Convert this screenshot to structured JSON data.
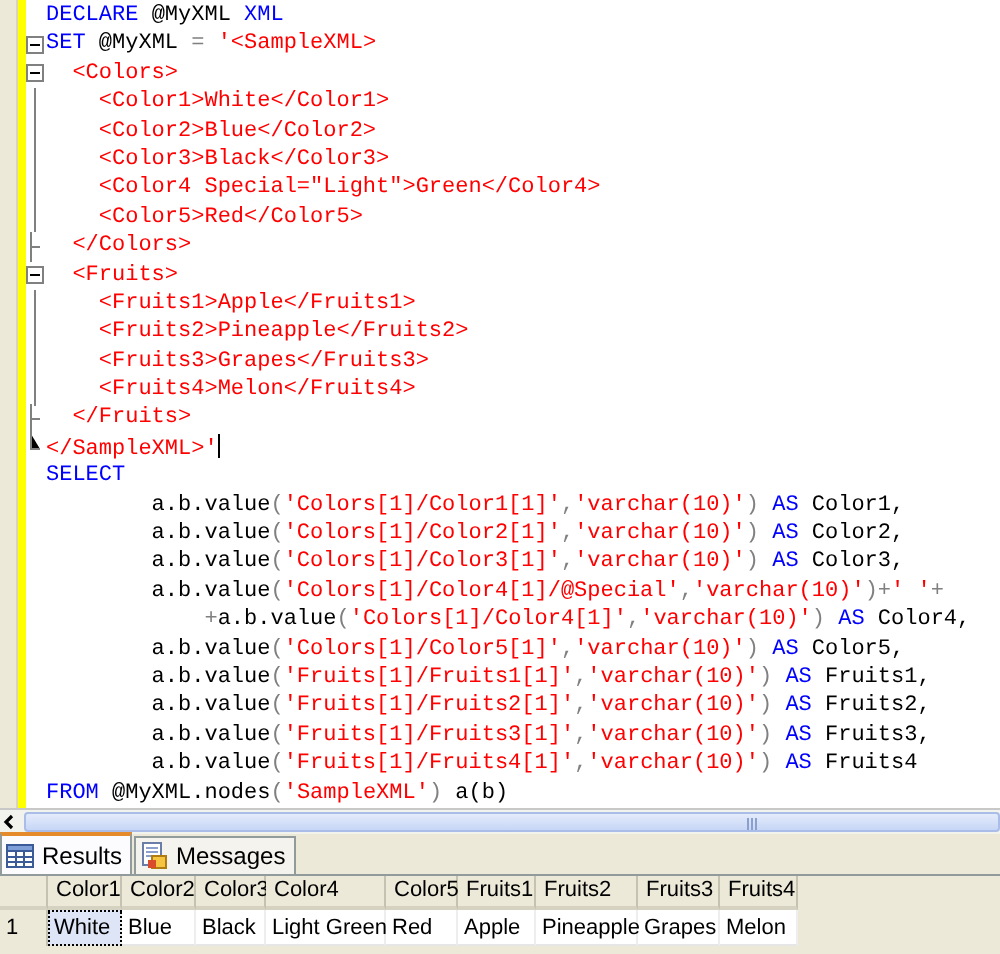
{
  "editor": {
    "lines": [
      {
        "kind": "plain",
        "cursor": false,
        "tokens": [
          {
            "kind": "keyword",
            "text": "DECLARE"
          },
          {
            "kind": "plain",
            "text": " @MyXML "
          },
          {
            "kind": "keyword",
            "text": "XML"
          }
        ]
      },
      {
        "kind": "open",
        "cursor": false,
        "tokens": [
          {
            "kind": "keyword",
            "text": "SET"
          },
          {
            "kind": "plain",
            "text": " @MyXML "
          },
          {
            "kind": "operator",
            "text": "= "
          },
          {
            "kind": "string",
            "text": "'<SampleXML>"
          }
        ]
      },
      {
        "kind": "open",
        "cursor": false,
        "tokens": [
          {
            "kind": "string",
            "text": "  <Colors>"
          }
        ]
      },
      {
        "kind": "line",
        "cursor": false,
        "tokens": [
          {
            "kind": "string",
            "text": "    <Color1>White</Color1>"
          }
        ]
      },
      {
        "kind": "line",
        "cursor": false,
        "tokens": [
          {
            "kind": "string",
            "text": "    <Color2>Blue</Color2>"
          }
        ]
      },
      {
        "kind": "line",
        "cursor": false,
        "tokens": [
          {
            "kind": "string",
            "text": "    <Color3>Black</Color3>"
          }
        ]
      },
      {
        "kind": "line",
        "cursor": false,
        "tokens": [
          {
            "kind": "string",
            "text": "    <Color4 Special=\"Light\">Green</Color4>"
          }
        ]
      },
      {
        "kind": "line",
        "cursor": false,
        "tokens": [
          {
            "kind": "string",
            "text": "    <Color5>Red</Color5>"
          }
        ]
      },
      {
        "kind": "end",
        "cursor": false,
        "tokens": [
          {
            "kind": "string",
            "text": "  </Colors>"
          }
        ]
      },
      {
        "kind": "open",
        "cursor": false,
        "tokens": [
          {
            "kind": "string",
            "text": "  <Fruits>"
          }
        ]
      },
      {
        "kind": "line",
        "cursor": false,
        "tokens": [
          {
            "kind": "string",
            "text": "    <Fruits1>Apple</Fruits1>"
          }
        ]
      },
      {
        "kind": "line",
        "cursor": false,
        "tokens": [
          {
            "kind": "string",
            "text": "    <Fruits2>Pineapple</Fruits2>"
          }
        ]
      },
      {
        "kind": "line",
        "cursor": false,
        "tokens": [
          {
            "kind": "string",
            "text": "    <Fruits3>Grapes</Fruits3>"
          }
        ]
      },
      {
        "kind": "line",
        "cursor": false,
        "tokens": [
          {
            "kind": "string",
            "text": "    <Fruits4>Melon</Fruits4>"
          }
        ]
      },
      {
        "kind": "end",
        "cursor": false,
        "tokens": [
          {
            "kind": "string",
            "text": "  </Fruits>"
          }
        ]
      },
      {
        "kind": "last",
        "cursor": true,
        "tokens": [
          {
            "kind": "string",
            "text": "</SampleXML>'"
          }
        ]
      },
      {
        "kind": "plain",
        "cursor": false,
        "tokens": [
          {
            "kind": "keyword",
            "text": "SELECT"
          }
        ]
      },
      {
        "kind": "plain",
        "cursor": false,
        "tokens": [
          {
            "kind": "plain",
            "text": "        a.b.value"
          },
          {
            "kind": "operator",
            "text": "("
          },
          {
            "kind": "string",
            "text": "'Colors[1]/Color1[1]'"
          },
          {
            "kind": "operator",
            "text": ","
          },
          {
            "kind": "string",
            "text": "'varchar(10)'"
          },
          {
            "kind": "operator",
            "text": ") "
          },
          {
            "kind": "keyword",
            "text": "AS"
          },
          {
            "kind": "plain",
            "text": " Color1,"
          }
        ]
      },
      {
        "kind": "plain",
        "cursor": false,
        "tokens": [
          {
            "kind": "plain",
            "text": "        a.b.value"
          },
          {
            "kind": "operator",
            "text": "("
          },
          {
            "kind": "string",
            "text": "'Colors[1]/Color2[1]'"
          },
          {
            "kind": "operator",
            "text": ","
          },
          {
            "kind": "string",
            "text": "'varchar(10)'"
          },
          {
            "kind": "operator",
            "text": ") "
          },
          {
            "kind": "keyword",
            "text": "AS"
          },
          {
            "kind": "plain",
            "text": " Color2,"
          }
        ]
      },
      {
        "kind": "plain",
        "cursor": false,
        "tokens": [
          {
            "kind": "plain",
            "text": "        a.b.value"
          },
          {
            "kind": "operator",
            "text": "("
          },
          {
            "kind": "string",
            "text": "'Colors[1]/Color3[1]'"
          },
          {
            "kind": "operator",
            "text": ","
          },
          {
            "kind": "string",
            "text": "'varchar(10)'"
          },
          {
            "kind": "operator",
            "text": ") "
          },
          {
            "kind": "keyword",
            "text": "AS"
          },
          {
            "kind": "plain",
            "text": " Color3,"
          }
        ]
      },
      {
        "kind": "plain",
        "cursor": false,
        "tokens": [
          {
            "kind": "plain",
            "text": "        a.b.value"
          },
          {
            "kind": "operator",
            "text": "("
          },
          {
            "kind": "string",
            "text": "'Colors[1]/Color4[1]/@Special'"
          },
          {
            "kind": "operator",
            "text": ","
          },
          {
            "kind": "string",
            "text": "'varchar(10)'"
          },
          {
            "kind": "operator",
            "text": ")+"
          },
          {
            "kind": "string",
            "text": "' '"
          },
          {
            "kind": "operator",
            "text": "+"
          }
        ]
      },
      {
        "kind": "plain",
        "cursor": false,
        "tokens": [
          {
            "kind": "operator",
            "text": "            +"
          },
          {
            "kind": "plain",
            "text": "a.b.value"
          },
          {
            "kind": "operator",
            "text": "("
          },
          {
            "kind": "string",
            "text": "'Colors[1]/Color4[1]'"
          },
          {
            "kind": "operator",
            "text": ","
          },
          {
            "kind": "string",
            "text": "'varchar(10)'"
          },
          {
            "kind": "operator",
            "text": ") "
          },
          {
            "kind": "keyword",
            "text": "AS"
          },
          {
            "kind": "plain",
            "text": " Color4,"
          }
        ]
      },
      {
        "kind": "plain",
        "cursor": false,
        "tokens": [
          {
            "kind": "plain",
            "text": "        a.b.value"
          },
          {
            "kind": "operator",
            "text": "("
          },
          {
            "kind": "string",
            "text": "'Colors[1]/Color5[1]'"
          },
          {
            "kind": "operator",
            "text": ","
          },
          {
            "kind": "string",
            "text": "'varchar(10)'"
          },
          {
            "kind": "operator",
            "text": ") "
          },
          {
            "kind": "keyword",
            "text": "AS"
          },
          {
            "kind": "plain",
            "text": " Color5,"
          }
        ]
      },
      {
        "kind": "plain",
        "cursor": false,
        "tokens": [
          {
            "kind": "plain",
            "text": "        a.b.value"
          },
          {
            "kind": "operator",
            "text": "("
          },
          {
            "kind": "string",
            "text": "'Fruits[1]/Fruits1[1]'"
          },
          {
            "kind": "operator",
            "text": ","
          },
          {
            "kind": "string",
            "text": "'varchar(10)'"
          },
          {
            "kind": "operator",
            "text": ") "
          },
          {
            "kind": "keyword",
            "text": "AS"
          },
          {
            "kind": "plain",
            "text": " Fruits1,"
          }
        ]
      },
      {
        "kind": "plain",
        "cursor": false,
        "tokens": [
          {
            "kind": "plain",
            "text": "        a.b.value"
          },
          {
            "kind": "operator",
            "text": "("
          },
          {
            "kind": "string",
            "text": "'Fruits[1]/Fruits2[1]'"
          },
          {
            "kind": "operator",
            "text": ","
          },
          {
            "kind": "string",
            "text": "'varchar(10)'"
          },
          {
            "kind": "operator",
            "text": ") "
          },
          {
            "kind": "keyword",
            "text": "AS"
          },
          {
            "kind": "plain",
            "text": " Fruits2,"
          }
        ]
      },
      {
        "kind": "plain",
        "cursor": false,
        "tokens": [
          {
            "kind": "plain",
            "text": "        a.b.value"
          },
          {
            "kind": "operator",
            "text": "("
          },
          {
            "kind": "string",
            "text": "'Fruits[1]/Fruits3[1]'"
          },
          {
            "kind": "operator",
            "text": ","
          },
          {
            "kind": "string",
            "text": "'varchar(10)'"
          },
          {
            "kind": "operator",
            "text": ") "
          },
          {
            "kind": "keyword",
            "text": "AS"
          },
          {
            "kind": "plain",
            "text": " Fruits3,"
          }
        ]
      },
      {
        "kind": "plain",
        "cursor": false,
        "tokens": [
          {
            "kind": "plain",
            "text": "        a.b.value"
          },
          {
            "kind": "operator",
            "text": "("
          },
          {
            "kind": "string",
            "text": "'Fruits[1]/Fruits4[1]'"
          },
          {
            "kind": "operator",
            "text": ","
          },
          {
            "kind": "string",
            "text": "'varchar(10)'"
          },
          {
            "kind": "operator",
            "text": ") "
          },
          {
            "kind": "keyword",
            "text": "AS"
          },
          {
            "kind": "plain",
            "text": " Fruits4"
          }
        ]
      },
      {
        "kind": "plain",
        "cursor": false,
        "tokens": [
          {
            "kind": "keyword",
            "text": "FROM"
          },
          {
            "kind": "plain",
            "text": " @MyXML.nodes"
          },
          {
            "kind": "operator",
            "text": "("
          },
          {
            "kind": "string",
            "text": "'SampleXML'"
          },
          {
            "kind": "operator",
            "text": ")"
          },
          {
            "kind": "plain",
            "text": " a(b)"
          }
        ]
      }
    ]
  },
  "results": {
    "tabs": [
      {
        "label": "Results",
        "kind": "grid",
        "selected": true
      },
      {
        "label": "Messages",
        "kind": "messages",
        "selected": false
      }
    ],
    "columns": [
      "Color1",
      "Color2",
      "Color3",
      "Color4",
      "Color5",
      "Fruits1",
      "Fruits2",
      "Fruits3",
      "Fruits4"
    ],
    "rows": [
      {
        "number": "1",
        "cells": [
          {
            "text": "White",
            "selected": true
          },
          {
            "text": "Blue",
            "selected": false
          },
          {
            "text": "Black",
            "selected": false
          },
          {
            "text": "Light Green",
            "selected": false
          },
          {
            "text": "Red",
            "selected": false
          },
          {
            "text": "Apple",
            "selected": false
          },
          {
            "text": "Pineapple",
            "selected": false
          },
          {
            "text": "Grapes",
            "selected": false
          },
          {
            "text": "Melon",
            "selected": false
          }
        ]
      }
    ]
  }
}
